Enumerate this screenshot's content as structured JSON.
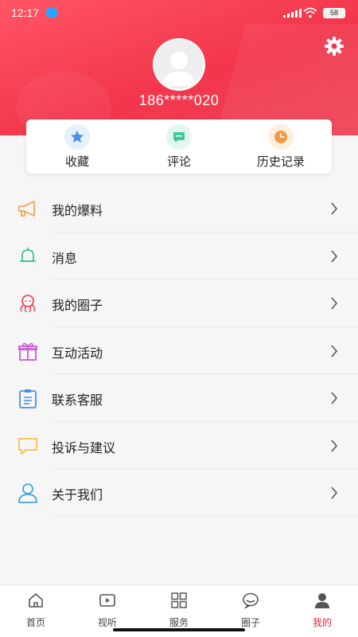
{
  "status_bar": {
    "time": "12:17",
    "battery": "58",
    "icons": [
      "cloud-app-icon",
      "signal-icon",
      "wifi-icon",
      "battery-icon"
    ]
  },
  "profile": {
    "phone": "186*****020",
    "avatar_icon": "default-avatar-icon",
    "settings_icon": "gear-icon"
  },
  "quick_actions": [
    {
      "label": "收藏",
      "icon": "star-icon",
      "color": "#4a90e2",
      "bg": "#e6f0fb"
    },
    {
      "label": "评论",
      "icon": "comment-icon",
      "color": "#3fc7a0",
      "bg": "#e3f7f1"
    },
    {
      "label": "历史记录",
      "icon": "clock-icon",
      "color": "#f29a4a",
      "bg": "#fdeede"
    }
  ],
  "menu": [
    {
      "label": "我的爆料",
      "icon": "megaphone-icon",
      "color": "#f2a65a"
    },
    {
      "label": "消息",
      "icon": "bell-icon",
      "color": "#3cc48f"
    },
    {
      "label": "我的圈子",
      "icon": "octopus-icon",
      "color": "#e84a5f"
    },
    {
      "label": "互动活动",
      "icon": "gift-icon",
      "color": "#c95bd6"
    },
    {
      "label": "联系客服",
      "icon": "clipboard-icon",
      "color": "#4a90e2"
    },
    {
      "label": "投诉与建议",
      "icon": "chat-bubble-icon",
      "color": "#f2c24a"
    },
    {
      "label": "关于我们",
      "icon": "person-icon",
      "color": "#3fa9d6"
    }
  ],
  "tabs": [
    {
      "label": "首页",
      "icon": "home-icon",
      "active": false
    },
    {
      "label": "视听",
      "icon": "play-icon",
      "active": false
    },
    {
      "label": "服务",
      "icon": "grid-icon",
      "active": false
    },
    {
      "label": "圈子",
      "icon": "circle-chat-icon",
      "active": false
    },
    {
      "label": "我的",
      "icon": "user-icon",
      "active": true
    }
  ],
  "colors": {
    "accent": "#e8283c",
    "header": "#f3364c"
  }
}
